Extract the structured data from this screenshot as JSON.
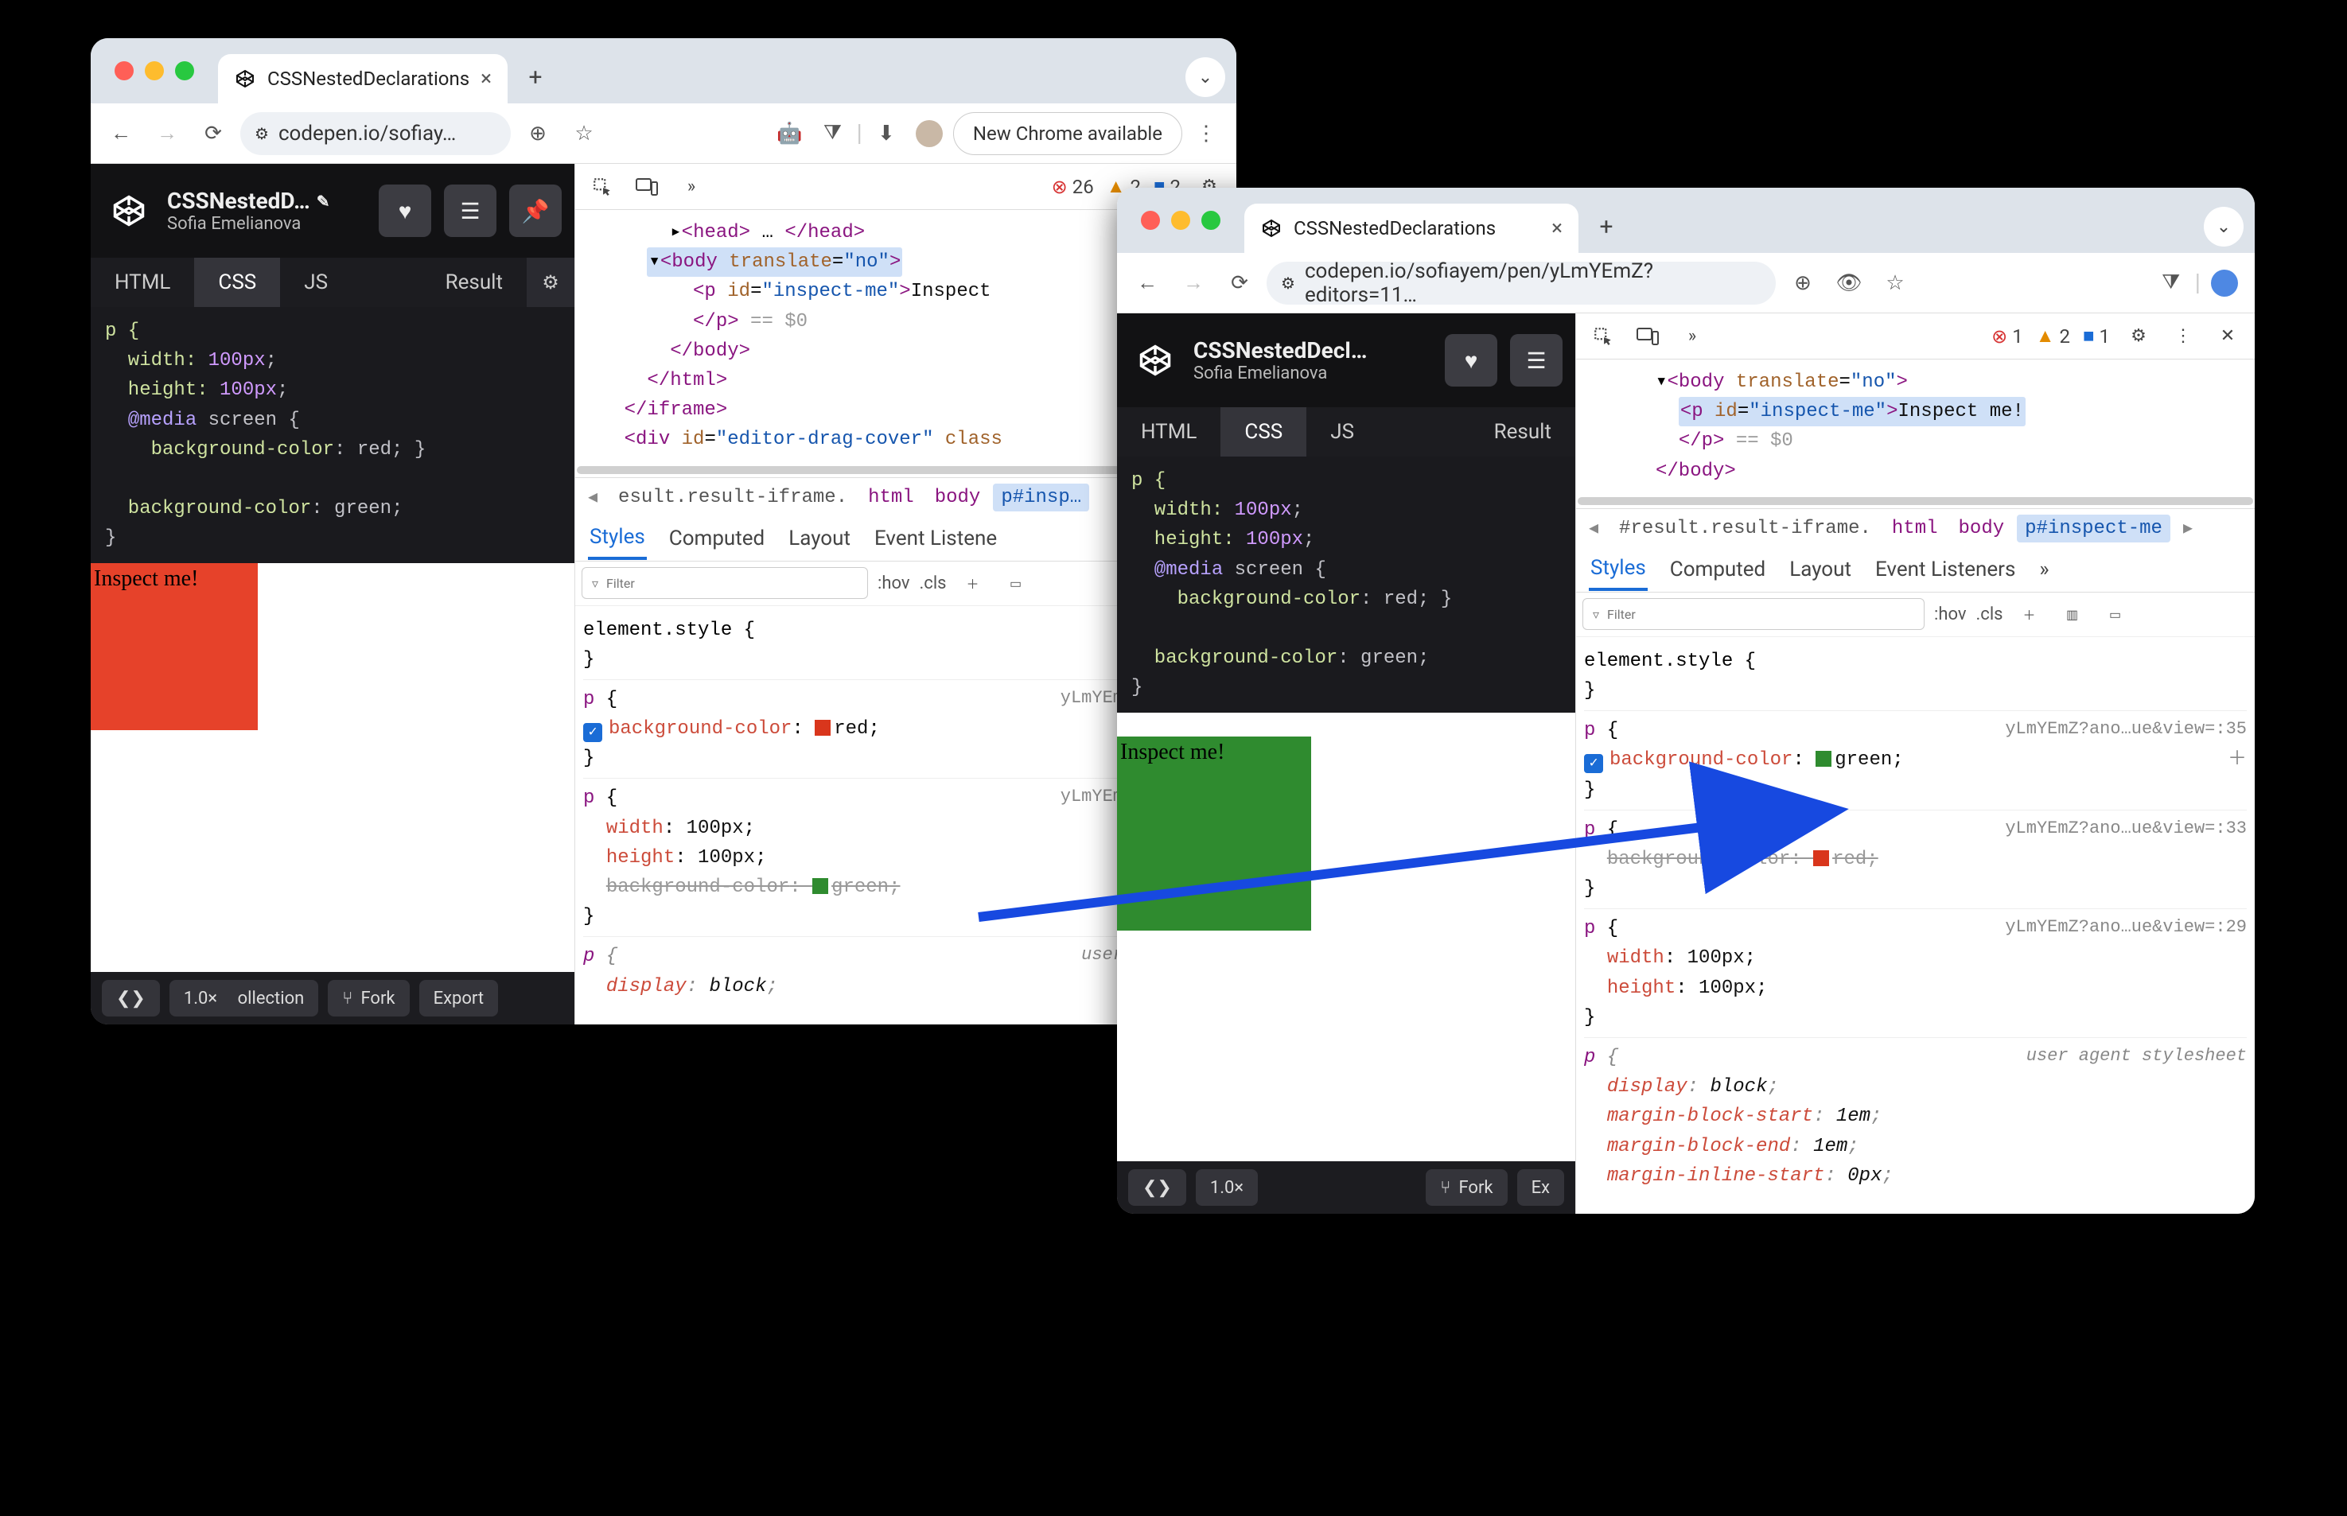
{
  "win1": {
    "tab_title": "CSSNestedDeclarations",
    "url_text": "codepen.io/sofiay…",
    "chrome_chip": "New Chrome available",
    "cp_title": "CSSNestedD…",
    "cp_author": "Sofia Emelianova",
    "cp_tabs": {
      "html": "HTML",
      "css": "CSS",
      "js": "JS",
      "result": "Result"
    },
    "css_code": {
      "l1": "p {",
      "l2": "  width:",
      "l2v": " 100px",
      "l3": "  height:",
      "l3v": " 100px",
      "l4": "  @media",
      "l4b": " screen {",
      "l5": "    background-color",
      "l5v": ": red; }",
      "l6": "  background-color",
      "l6v": ": green;",
      "l7": "}"
    },
    "inspect_text": "Inspect me!",
    "footer": {
      "zoom": "1.0×",
      "col": "ollection",
      "fork": "Fork",
      "export": "Export"
    },
    "dt": {
      "err": "26",
      "warn": "2",
      "info": "2",
      "crumbs": {
        "iframe": "esult.result-iframe.",
        "html": "html",
        "body": "body",
        "sel": "p#insp…"
      },
      "tabs": {
        "styles": "Styles",
        "computed": "Computed",
        "layout": "Layout",
        "listeners": "Event Listene"
      },
      "filter": "Filter",
      "hov": ":hov",
      "cls": ".cls",
      "src": "yLmYEmZ?noc…ue&v",
      "rules": {
        "elstyle": "element.style {",
        "r1_bg": "background-color",
        "r1_v": "red",
        "r2_w": "width",
        "r2_wv": "100px",
        "r2_h": "height",
        "r2_hv": "100px",
        "r2_bg": "background-color",
        "r2_bv": "green",
        "ua": "user agent sty",
        "disp": "display",
        "dispv": "block"
      }
    },
    "elements": {
      "head": "<head>",
      "head2": "</head>",
      "body_open": "<body",
      "body_attr": " translate",
      "body_val": "\"no\"",
      "p_open": "<p",
      "p_attr": " id",
      "p_val": "\"inspect-me\"",
      "p_txt": "Inspect",
      "p_close": "</p>",
      "eq0": " == $0",
      "body_close": "</body>",
      "html_close": "</html>",
      "iframe_close": "</iframe>",
      "div": "<div",
      "div_attr": " id",
      "div_val": "\"editor-drag-cover\"",
      "div_cls": " class"
    }
  },
  "win2": {
    "tab_title": "CSSNestedDeclarations",
    "url_text": "codepen.io/sofiayem/pen/yLmYEmZ?editors=11…",
    "cp_title": "CSSNestedDecl…",
    "cp_author": "Sofia Emelianova",
    "cp_tabs": {
      "html": "HTML",
      "css": "CSS",
      "js": "JS",
      "result": "Result"
    },
    "css_code": {
      "l1": "p {",
      "l2": "  width:",
      "l2v": " 100px",
      "l3": "  height:",
      "l3v": " 100px",
      "l4": "  @media",
      "l4b": " screen {",
      "l5": "    background-color",
      "l5v": ": red; }",
      "l6": "  background-color",
      "l6v": ": green;",
      "l7": "}"
    },
    "inspect_text": "Inspect me!",
    "footer": {
      "zoom": "1.0×",
      "fork": "Fork",
      "export": "Ex"
    },
    "dt": {
      "err": "1",
      "warn": "2",
      "info": "1",
      "crumbs": {
        "iframe": "#result.result-iframe.",
        "html": "html",
        "body": "body",
        "sel": "p#inspect-me"
      },
      "tabs": {
        "styles": "Styles",
        "computed": "Computed",
        "layout": "Layout",
        "listeners": "Event Listeners"
      },
      "filter": "Filter",
      "hov": ":hov",
      "cls": ".cls",
      "src35": "yLmYEmZ?ano…ue&view=:35",
      "src33": "yLmYEmZ?ano…ue&view=:33",
      "src29": "yLmYEmZ?ano…ue&view=:29",
      "rules": {
        "elstyle": "element.style {",
        "r1_bg": "background-color",
        "r1_v": "green",
        "r2_bg": "background-color",
        "r2_v": "red",
        "r3_w": "width",
        "r3_wv": "100px",
        "r3_h": "height",
        "r3_hv": "100px",
        "ua": "user agent stylesheet",
        "disp": "display",
        "dispv": "block",
        "mbs": "margin-block-start",
        "mbsv": "1em",
        "mbe": "margin-block-end",
        "mbev": "1em",
        "mis": "margin-inline-start",
        "misv": "0px"
      }
    },
    "elements": {
      "body_open": "<body",
      "body_attr": " translate",
      "body_val": "\"no\"",
      "p_open": "<p",
      "p_attr": " id",
      "p_val": "\"inspect-me\"",
      "p_txt": "Inspect me!",
      "p_close": "</p>",
      "eq0": " == $0",
      "body_close": "</body>"
    }
  }
}
